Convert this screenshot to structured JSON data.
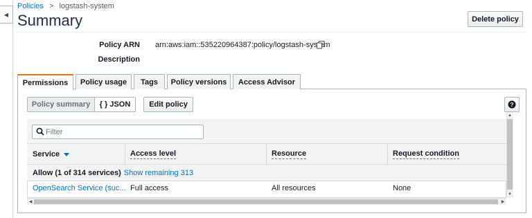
{
  "breadcrumb": {
    "parent": "Policies",
    "separator": ">",
    "current": "logstash-system"
  },
  "page": {
    "title": "Summary",
    "delete_label": "Delete policy"
  },
  "summary": {
    "arn_label": "Policy ARN",
    "arn_value": "arn:aws:iam::535220964387:policy/logstash-system",
    "description_label": "Description"
  },
  "tabs": [
    {
      "label": "Permissions",
      "active": true
    },
    {
      "label": "Policy usage"
    },
    {
      "label": "Tags"
    },
    {
      "label": "Policy versions"
    },
    {
      "label": "Access Advisor"
    }
  ],
  "toolbar": {
    "summary_label": "Policy summary",
    "json_label": "{ } JSON",
    "edit_label": "Edit policy",
    "help_label": "?"
  },
  "filter": {
    "placeholder": "Filter"
  },
  "table": {
    "headers": [
      "Service",
      "Access level",
      "Resource",
      "Request condition"
    ],
    "group": {
      "label": "Allow (1 of 314 services)",
      "link": "Show remaining 313"
    },
    "rows": [
      {
        "service": "OpenSearch Service (suc...",
        "access": "Full access",
        "resource": "All resources",
        "condition": "None"
      }
    ]
  },
  "colors": {
    "link": "#0073bb",
    "active_tab": "#ec7211",
    "border": "#aab7b8",
    "header_bg": "#f2f3f3"
  },
  "icons": [
    "collapse-arrow-icon",
    "copy-icon",
    "search-icon",
    "sort-down-icon",
    "help-icon"
  ]
}
